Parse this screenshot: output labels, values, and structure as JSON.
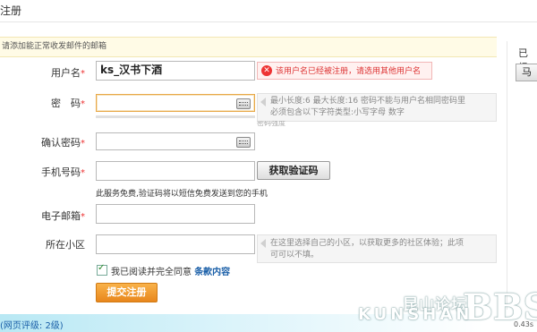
{
  "page": {
    "title": "注册"
  },
  "notice": "请添加能正常收发邮件的邮箱",
  "form": {
    "username": {
      "label": "用户名",
      "required": "*",
      "value": "ks_汉书下酒",
      "error": "该用户名已经被注册，请选用其他用户名"
    },
    "password": {
      "label": "密　码",
      "required": "*",
      "hint_line1": "最小长度:6 最大长度:16 密码不能与用户名相同密码里",
      "hint_line2": "必须包含以下字符类型:小写字母 数字",
      "hint_line3": "密码强度"
    },
    "confirm": {
      "label": "确认密码",
      "required": "*"
    },
    "phone": {
      "label": "手机号码",
      "required": "*",
      "sms_button": "获取验证码",
      "note": "此服务免费,验证码将以短信免费发送到您的手机"
    },
    "email": {
      "label": "电子邮箱",
      "required": "*"
    },
    "community": {
      "label": "所在小区",
      "hint_line1": "在这里选择自己的小区，以获取更多的社区体验；此项",
      "hint_line2": "可可以不填。"
    },
    "agree": {
      "text": "我已阅读并完全同意",
      "link": "条款内容",
      "checked": true
    },
    "submit": "提交注册"
  },
  "sidebar": {
    "text": "已经",
    "button": "马"
  },
  "status": {
    "text": "(网页评级: 2级)",
    "zoom": "0.43s"
  },
  "watermark": {
    "cn": "昆山论坛",
    "en": "KUNSHAN",
    "bbs": "BBS"
  },
  "colors": {
    "required": "#ee3333",
    "error_bg": "#fff1f0",
    "submit": "#f0a030",
    "link": "#1a5fa8"
  }
}
